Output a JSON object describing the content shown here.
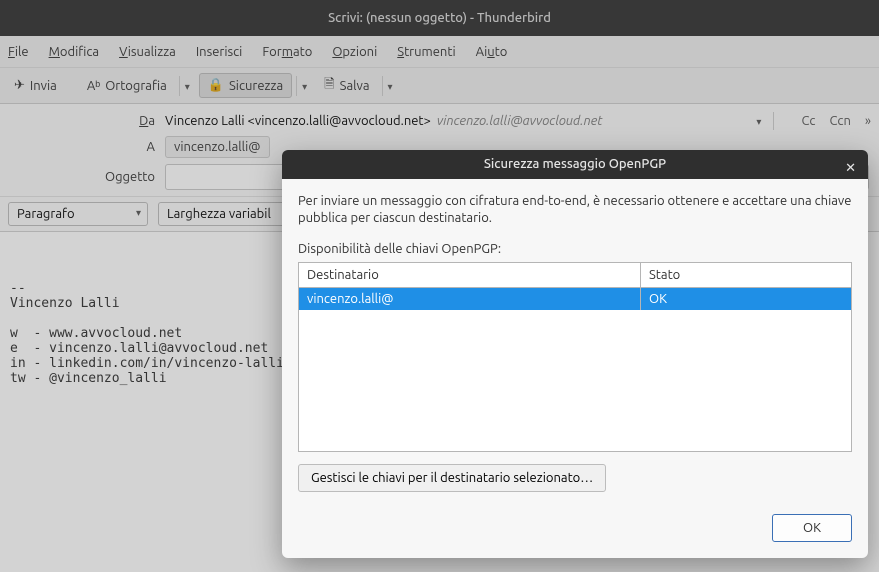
{
  "window": {
    "title": "Scrivi: (nessun oggetto) - Thunderbird"
  },
  "menu": {
    "file": "File",
    "modifica": "Modifica",
    "visualizza": "Visualizza",
    "inserisci": "Inserisci",
    "formato": "Formato",
    "opzioni": "Opzioni",
    "strumenti": "Strumenti",
    "aiuto": "Aiuto"
  },
  "toolbar": {
    "invia": "Invia",
    "ortografia": "Ortografia",
    "sicurezza": "Sicurezza",
    "salva": "Salva"
  },
  "headers": {
    "da_label": "Da",
    "from_display": "Vincenzo Lalli <vincenzo.lalli@avvocloud.net>",
    "from_identity": "vincenzo.lalli@avvocloud.net",
    "a_label": "A",
    "to_value": "vincenzo.lalli@",
    "cc": "Cc",
    "ccn": "Ccn",
    "oggetto_label": "Oggetto",
    "oggetto_value": ""
  },
  "format": {
    "paragraph": "Paragrafo",
    "width": "Larghezza variabil"
  },
  "body": "\n\n--\nVincenzo Lalli\n\nw  - www.avvocloud.net\ne  - vincenzo.lalli@avvocloud.net\nin - linkedin.com/in/vincenzo-lalli\ntw - @vincenzo_lalli",
  "dialog": {
    "title": "Sicurezza messaggio OpenPGP",
    "message": "Per inviare un messaggio con cifratura end-to-end, è necessario ottenere e accettare una chiave pubblica per ciascun destinatario.",
    "availability": "Disponibilità delle chiavi OpenPGP:",
    "col_recipient": "Destinatario",
    "col_status": "Stato",
    "rows": [
      {
        "recipient": "vincenzo.lalli@",
        "status": "OK"
      }
    ],
    "manage": "Gestisci le chiavi per il destinatario selezionato…",
    "ok": "OK"
  }
}
